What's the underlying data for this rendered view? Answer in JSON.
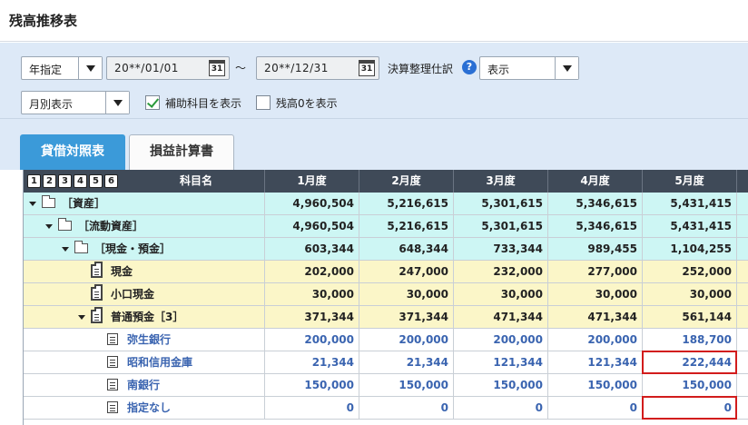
{
  "window": {
    "title": "残高推移表"
  },
  "filters": {
    "period_type": "年指定",
    "date_from": "20**/01/01",
    "date_to": "20**/12/31",
    "range_sep": "～",
    "calendar_glyph": "31",
    "closing_label": "決算整理仕訳",
    "closing_value": "表示",
    "help_glyph": "?",
    "view_mode": "月別表示",
    "show_sub_accounts": {
      "label": "補助科目を表示",
      "checked": true
    },
    "show_zero_balance": {
      "label": "残高0を表示",
      "checked": false
    }
  },
  "tabs": [
    {
      "label": "貸借対照表",
      "active": true
    },
    {
      "label": "損益計算書",
      "active": false
    }
  ],
  "table": {
    "level_buttons": [
      "1",
      "2",
      "3",
      "4",
      "5",
      "6"
    ],
    "columns": [
      "科目名",
      "1月度",
      "2月度",
      "3月度",
      "4月度",
      "5月度"
    ],
    "rows": [
      {
        "name": "［資産］",
        "icon": "folder-icon",
        "expand": true,
        "indent": 0,
        "color": "cyan",
        "values": [
          "4,960,504",
          "5,216,615",
          "5,301,615",
          "5,346,615",
          "5,431,415"
        ]
      },
      {
        "name": "［流動資産］",
        "icon": "folder-icon",
        "expand": true,
        "indent": 1,
        "color": "cyan",
        "values": [
          "4,960,504",
          "5,216,615",
          "5,301,615",
          "5,346,615",
          "5,431,415"
        ]
      },
      {
        "name": "［現金・預金］",
        "icon": "folder-icon",
        "expand": true,
        "indent": 2,
        "color": "cyan",
        "values": [
          "603,344",
          "648,344",
          "733,344",
          "989,455",
          "1,104,255"
        ]
      },
      {
        "name": "現金",
        "icon": "ledger-icon",
        "expand": false,
        "indent": 3,
        "color": "yellow",
        "values": [
          "202,000",
          "247,000",
          "232,000",
          "277,000",
          "252,000"
        ]
      },
      {
        "name": "小口現金",
        "icon": "ledger-icon",
        "expand": false,
        "indent": 3,
        "color": "yellow",
        "values": [
          "30,000",
          "30,000",
          "30,000",
          "30,000",
          "30,000"
        ]
      },
      {
        "name": "普通預金［3］",
        "icon": "ledger-icon",
        "expand": true,
        "indent": 3,
        "color": "yellow",
        "values": [
          "371,344",
          "371,344",
          "471,344",
          "471,344",
          "561,144"
        ]
      },
      {
        "name": "弥生銀行",
        "icon": "sub-ledger-icon",
        "expand": false,
        "indent": 4,
        "color": "white",
        "values": [
          "200,000",
          "200,000",
          "200,000",
          "200,000",
          "188,700"
        ]
      },
      {
        "name": "昭和信用金庫",
        "icon": "sub-ledger-icon",
        "expand": false,
        "indent": 4,
        "color": "white",
        "values": [
          "21,344",
          "21,344",
          "121,344",
          "121,344",
          "222,444"
        ]
      },
      {
        "name": "南銀行",
        "icon": "sub-ledger-icon",
        "expand": false,
        "indent": 4,
        "color": "white",
        "values": [
          "150,000",
          "150,000",
          "150,000",
          "150,000",
          "150,000"
        ]
      },
      {
        "name": "指定なし",
        "icon": "sub-ledger-icon",
        "expand": false,
        "indent": 4,
        "color": "white",
        "values": [
          "0",
          "0",
          "0",
          "0",
          "0"
        ]
      }
    ]
  },
  "highlights": [
    {
      "row": 7,
      "column": 5,
      "color": "#d21c1c"
    },
    {
      "row": 9,
      "column": 5,
      "color": "#d21c1c"
    }
  ],
  "colors": {
    "header_bg": "#3f4a58",
    "row_cyan": "#cdf6f4",
    "row_yellow": "#fbf6c8",
    "sub_account_text": "#3a64b0",
    "active_tab": "#3b9ad9",
    "filter_bar": "#dde9f7"
  }
}
